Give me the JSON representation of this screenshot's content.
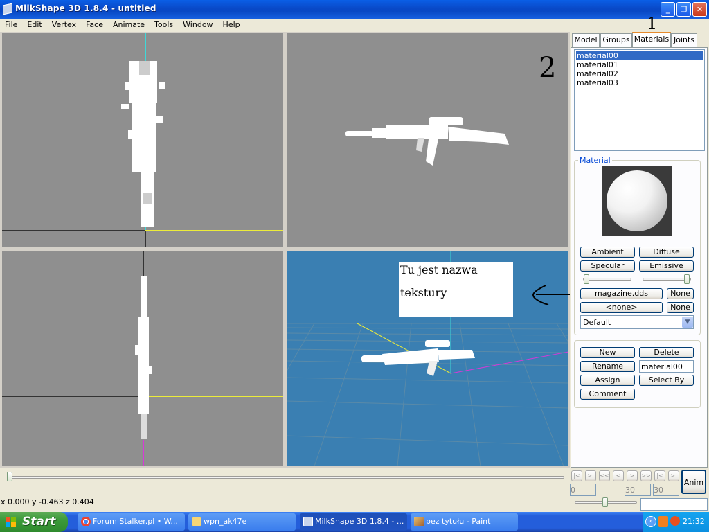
{
  "window": {
    "title": "MilkShape 3D 1.8.4 - untitled",
    "minimize_glyph": "_",
    "maximize_glyph": "❐",
    "close_glyph": "✕"
  },
  "menu": [
    "File",
    "Edit",
    "Vertex",
    "Face",
    "Animate",
    "Tools",
    "Window",
    "Help"
  ],
  "tabs": {
    "model": "Model",
    "groups": "Groups",
    "materials": "Materials",
    "joints": "Joints",
    "active": "Materials"
  },
  "materials_list": [
    "material00",
    "material01",
    "material02",
    "material03"
  ],
  "material_group": {
    "label": "Material",
    "ambient": "Ambient",
    "diffuse": "Diffuse",
    "specular": "Specular",
    "emissive": "Emissive",
    "texture1": "magazine.dds",
    "texture1_none": "None",
    "texture2": "<none>",
    "texture2_none": "None",
    "mode": "Default"
  },
  "actions": {
    "new": "New",
    "delete": "Delete",
    "rename": "Rename",
    "name_value": "material00",
    "assign": "Assign",
    "select_by": "Select By",
    "comment": "Comment"
  },
  "annotations": {
    "note_line1": "Tu jest nazwa",
    "note_line2": "tekstury",
    "mark1": "1",
    "mark2": "2"
  },
  "animation": {
    "buttons": [
      "|<",
      ">|",
      "<<",
      "<",
      ">",
      ">>",
      "|<",
      ">|"
    ],
    "frame_current": "0",
    "frame_start": "30",
    "frame_end": "30",
    "anim_label": "Anim"
  },
  "status": {
    "coords": "x 0.000 y -0.463 z 0.404"
  },
  "taskbar": {
    "start": "Start",
    "items": [
      "Forum Stalker.pl • W...",
      "wpn_ak47e",
      "MilkShape 3D 1.8.4 - ...",
      "bez tytułu - Paint"
    ],
    "clock": "21:32"
  },
  "colors": {
    "viewport_bg": "#8f8f8f",
    "viewport_3d_bg": "#3a7fb2",
    "axis_cyan": "#3fd8d8",
    "axis_yellow": "#ecec3a",
    "axis_magenta": "#d838d8",
    "selection_blue": "#316ac5"
  },
  "icons": [
    "app-icon",
    "minimize-icon",
    "maximize-icon",
    "close-icon",
    "windows-logo-icon",
    "chrome-icon",
    "folder-icon",
    "milkshape-icon",
    "paint-icon",
    "tray-arrow-icon",
    "tray-media-icon",
    "tray-network-icon",
    "dropdown-arrow-icon"
  ]
}
